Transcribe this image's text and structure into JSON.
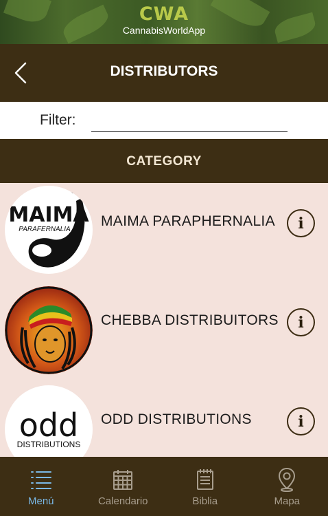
{
  "banner": {
    "brand_mark": "CWA",
    "brand_sub": "CannabisWorldApp"
  },
  "header": {
    "title": "DISTRIBUTORS",
    "back_icon": "chevron-left-icon"
  },
  "filter": {
    "label": "Filter:",
    "value": "",
    "placeholder": ""
  },
  "category": {
    "title": "CATEGORY"
  },
  "distributors": [
    {
      "name": "MAIMA PARAPHERNALIA",
      "logo_text": "MAIMA",
      "logo_subtext": "PARAFERNALIA",
      "logo_icon": "pipe-logo",
      "info_icon": "info-icon"
    },
    {
      "name": "CHEBBA DISTRIBUITORS",
      "logo_icon": "rasta-lion-logo",
      "info_icon": "info-icon"
    },
    {
      "name": "ODD DISTRIBUTIONS",
      "logo_text": "odd",
      "logo_subtext": "DISTRIBUTIONS",
      "logo_icon": "odd-logo",
      "info_icon": "info-icon"
    }
  ],
  "tabs": [
    {
      "label": "Menú",
      "icon": "list-menu-icon",
      "active": true
    },
    {
      "label": "Calendario",
      "icon": "calendar-icon",
      "active": false
    },
    {
      "label": "Biblia",
      "icon": "notebook-icon",
      "active": false
    },
    {
      "label": "Mapa",
      "icon": "map-pin-icon",
      "active": false
    }
  ],
  "colors": {
    "header": "#3d2e14",
    "list_bg": "#f4e2dc",
    "active_tab": "#7ab8e6",
    "inactive_tab": "#a89e8e",
    "brand": "#b8c94a"
  }
}
